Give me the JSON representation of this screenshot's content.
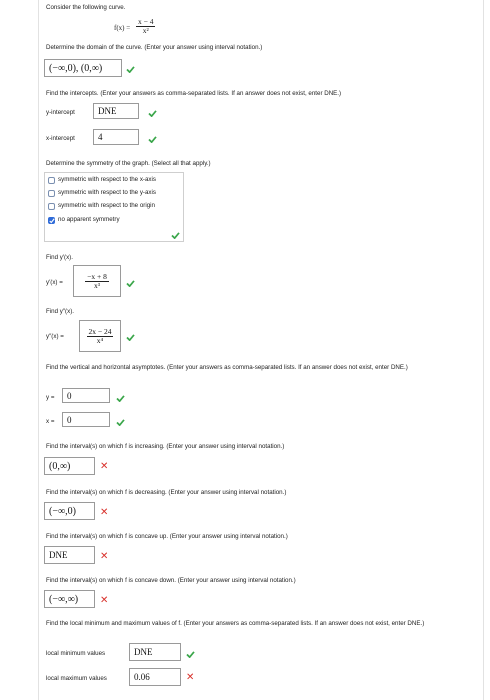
{
  "intro": "Consider the following curve.",
  "curve": {
    "lhs": "f(x) =",
    "num": "x − 4",
    "den": "x²"
  },
  "domain": {
    "prompt": "Determine the domain of the curve. (Enter your answer using interval notation.)",
    "answer": "(−∞,0), (0,∞)",
    "status": "correct"
  },
  "intercepts": {
    "prompt": "Find the intercepts. (Enter your answers as comma-separated lists. If an answer does not exist, enter DNE.)",
    "y_label": "y-intercept",
    "y_value": "DNE",
    "x_label": "x-intercept",
    "x_value": "4"
  },
  "symmetry": {
    "prompt": "Determine the symmetry of the graph. (Select all that apply.)",
    "options": [
      {
        "label": "symmetric with respect to the x-axis",
        "checked": false
      },
      {
        "label": "symmetric with respect to the y-axis",
        "checked": false
      },
      {
        "label": "symmetric with respect to the origin",
        "checked": false
      },
      {
        "label": "no apparent symmetry",
        "checked": true
      }
    ]
  },
  "first_derivative": {
    "prompt": "Find y′(x).",
    "lhs": "y′(x) =",
    "num": "−x + 8",
    "den": "x³"
  },
  "second_derivative": {
    "prompt": "Find y″(x).",
    "lhs": "y″(x) =",
    "num": "2x − 24",
    "den": "x⁴"
  },
  "asymptotes": {
    "prompt": "Find the vertical and horizontal asymptotes. (Enter your answers as comma-separated lists. If an answer does not exist, enter DNE.)",
    "y_label": "y =",
    "y_value": "0",
    "x_label": "x =",
    "x_value": "0"
  },
  "increasing": {
    "prompt": "Find the interval(s) on which f is increasing. (Enter your answer using interval notation.)",
    "answer": "(0,∞)"
  },
  "decreasing": {
    "prompt": "Find the interval(s) on which f is decreasing. (Enter your answer using interval notation.)",
    "answer": "(−∞,0)"
  },
  "concave_up": {
    "prompt": "Find the interval(s) on which f is concave up. (Enter your answer using interval notation.)",
    "answer": "DNE"
  },
  "concave_down": {
    "prompt": "Find the interval(s) on which f is concave down. (Enter your answer using interval notation.)",
    "answer": "(−∞,∞)"
  },
  "extrema": {
    "prompt": "Find the local minimum and maximum values of f. (Enter your answers as comma-separated lists. If an answer does not exist, enter DNE.)",
    "min_label": "local minimum values",
    "min_value": "DNE",
    "max_label": "local maximum values",
    "max_value": "0.06"
  },
  "colors": {
    "correct": "#3aa64a",
    "incorrect": "#d8302a",
    "checkbox": "#2f6bd8"
  }
}
